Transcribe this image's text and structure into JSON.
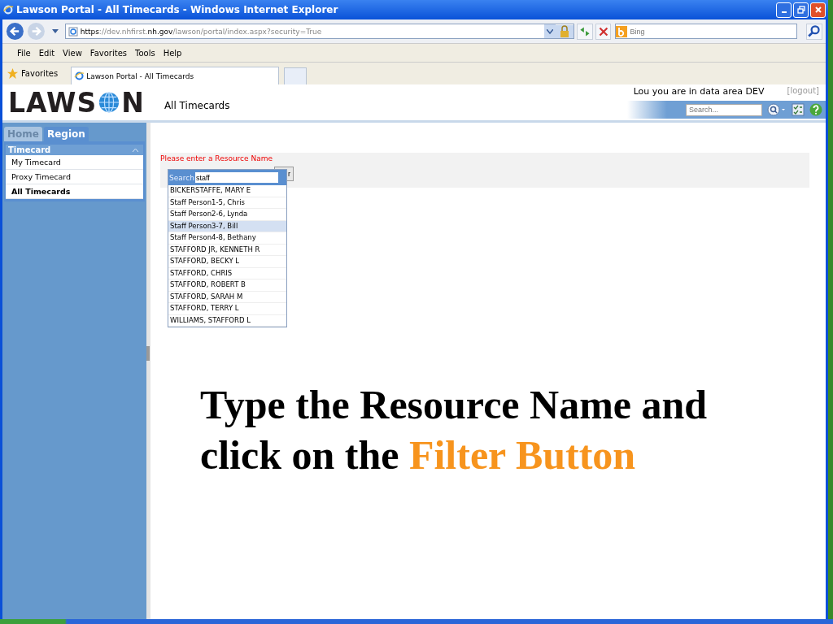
{
  "window": {
    "title": "Lawson Portal - All Timecards - Windows Internet Explorer"
  },
  "address_bar": {
    "url_parts": [
      {
        "text": "https",
        "emphasis": true
      },
      {
        "text": "://dev.nhfirst.",
        "emphasis": false
      },
      {
        "text": "nh.gov",
        "emphasis": true
      },
      {
        "text": "/lawson/portal/index.aspx?security=True",
        "emphasis": false
      }
    ]
  },
  "search_box": {
    "placeholder": "Bing"
  },
  "menu_bar": [
    "File",
    "Edit",
    "View",
    "Favorites",
    "Tools",
    "Help"
  ],
  "favorites_bar": {
    "label": "Favorites",
    "tabs": [
      {
        "label": "Lawson Portal - All Timecards",
        "selected": true
      }
    ]
  },
  "portal": {
    "logo": {
      "before": "LAWS",
      "after": "N"
    },
    "page_title": "All Timecards",
    "user_info": "Lou you are in data area DEV",
    "logout": "[logout]",
    "search": {
      "placeholder": "Search..."
    }
  },
  "sidebar": {
    "tabs": [
      {
        "label": "Home",
        "selected": false
      },
      {
        "label": "Region",
        "selected": true
      }
    ],
    "section": "Timecard",
    "items": [
      {
        "label": "My Timecard",
        "selected": false
      },
      {
        "label": "Proxy Timecard",
        "selected": false
      },
      {
        "label": "All Timecards",
        "selected": true
      }
    ]
  },
  "main": {
    "message": "Please enter a Resource Name",
    "filter_button": "r",
    "dropdown": {
      "search_label": "Search",
      "search_value": "staff",
      "options": [
        {
          "label": "BICKERSTAFFE, MARY E",
          "selected": false
        },
        {
          "label": "Staff Person1-5, Chris",
          "selected": false
        },
        {
          "label": "Staff Person2-6, Lynda",
          "selected": false
        },
        {
          "label": "Staff Person3-7, Bill",
          "selected": true
        },
        {
          "label": "Staff Person4-8, Bethany",
          "selected": false
        },
        {
          "label": "STAFFORD JR, KENNETH R",
          "selected": false
        },
        {
          "label": "STAFFORD, BECKY L",
          "selected": false
        },
        {
          "label": "STAFFORD, CHRIS",
          "selected": false
        },
        {
          "label": "STAFFORD, ROBERT B",
          "selected": false
        },
        {
          "label": "STAFFORD, SARAH M",
          "selected": false
        },
        {
          "label": "STAFFORD, TERRY L",
          "selected": false
        },
        {
          "label": "WILLIAMS, STAFFORD L",
          "selected": false
        }
      ]
    }
  },
  "caption": {
    "text": "Type the Resource Name and click on the",
    "highlight": "Filter Button"
  }
}
